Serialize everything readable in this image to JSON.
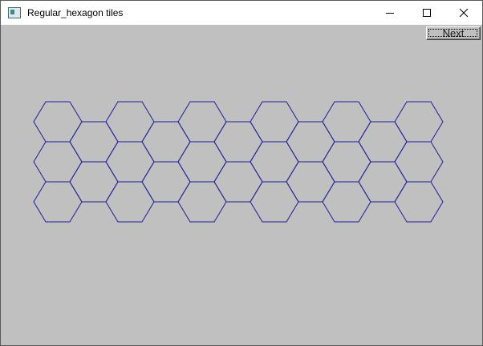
{
  "window": {
    "title": "Regular_hexagon tiles"
  },
  "toolbar": {
    "next_label": "Next"
  },
  "colors": {
    "background": "#c0c0c0",
    "hex_stroke": "#1c1c9a"
  },
  "hex_grid": {
    "shape": "regular-hexagon",
    "columns": 11,
    "rows": 3,
    "visible_tiles": 21
  }
}
